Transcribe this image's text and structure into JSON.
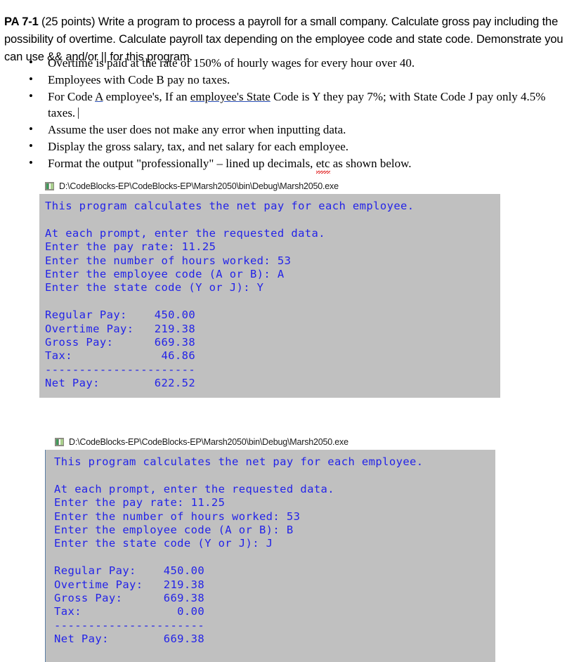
{
  "assignment": {
    "label": "PA 7-1",
    "body": " (25 points) Write a program to process a payroll for a small company.  Calculate gross pay including the possibility of overtime.  Calculate payroll tax depending on the employee code and state code.  Demonstrate you can use && and/or || for this program."
  },
  "requirements": [
    {
      "bullet": "•",
      "text": "Overtime is paid at the rate of 150% of hourly wages for every hour over 40."
    },
    {
      "bullet": "•",
      "text": "Employees with Code B pay no taxes."
    },
    {
      "bullet": "•",
      "segments": {
        "lead": "For Code ",
        "underlined_a": "A",
        "mid": " employee's, If an ",
        "underlined_phrase": "employee's  State",
        "tail": " Code is Y they pay  7%; with State Code J pay only 4.5% taxes."
      }
    },
    {
      "bullet": "•",
      "text": "Assume the user does not make any error when inputting data."
    },
    {
      "bullet": "•",
      "text": "Display the gross salary, tax, and net salary for each employee."
    },
    {
      "bullet": "•",
      "segments": {
        "lead": "Format the output \"professionally\" – lined up decimals, ",
        "misspelled": "etc",
        "tail": " as shown below."
      }
    }
  ],
  "console_windows": [
    {
      "title": "D:\\CodeBlocks-EP\\CodeBlocks-EP\\Marsh2050\\bin\\Debug\\Marsh2050.exe",
      "icon": "codeblocks-console-icon",
      "lines": [
        "This program calculates the net pay for each employee.",
        "",
        "At each prompt, enter the requested data.",
        "Enter the pay rate: 11.25",
        "Enter the number of hours worked: 53",
        "Enter the employee code (A or B): A",
        "Enter the state code (Y or J): Y",
        "",
        "Regular Pay:    450.00",
        "Overtime Pay:   219.38",
        "Gross Pay:      669.38",
        "Tax:             46.86",
        "----------------------",
        "Net Pay:        622.52"
      ],
      "inputs": {
        "pay_rate": "11.25",
        "hours_worked": "53",
        "employee_code": "A",
        "state_code": "Y"
      },
      "results": {
        "regular_pay": "450.00",
        "overtime_pay": "219.38",
        "gross_pay": "669.38",
        "tax": "46.86",
        "net_pay": "622.52"
      }
    },
    {
      "title": "D:\\CodeBlocks-EP\\CodeBlocks-EP\\Marsh2050\\bin\\Debug\\Marsh2050.exe",
      "icon": "codeblocks-console-icon",
      "lines": [
        "This program calculates the net pay for each employee.",
        "",
        "At each prompt, enter the requested data.",
        "Enter the pay rate: 11.25",
        "Enter the number of hours worked: 53",
        "Enter the employee code (A or B): B",
        "Enter the state code (Y or J): J",
        "",
        "Regular Pay:    450.00",
        "Overtime Pay:   219.38",
        "Gross Pay:      669.38",
        "Tax:              0.00",
        "----------------------",
        "Net Pay:        669.38"
      ],
      "inputs": {
        "pay_rate": "11.25",
        "hours_worked": "53",
        "employee_code": "B",
        "state_code": "J"
      },
      "results": {
        "regular_pay": "450.00",
        "overtime_pay": "219.38",
        "gross_pay": "669.38",
        "tax": "0.00",
        "net_pay": "669.38"
      }
    }
  ],
  "colors": {
    "console_background": "#c0c0c0",
    "console_text": "#2323e8",
    "underline_blue": "#2a4fb5",
    "spellcheck_red": "#e01b1b"
  }
}
